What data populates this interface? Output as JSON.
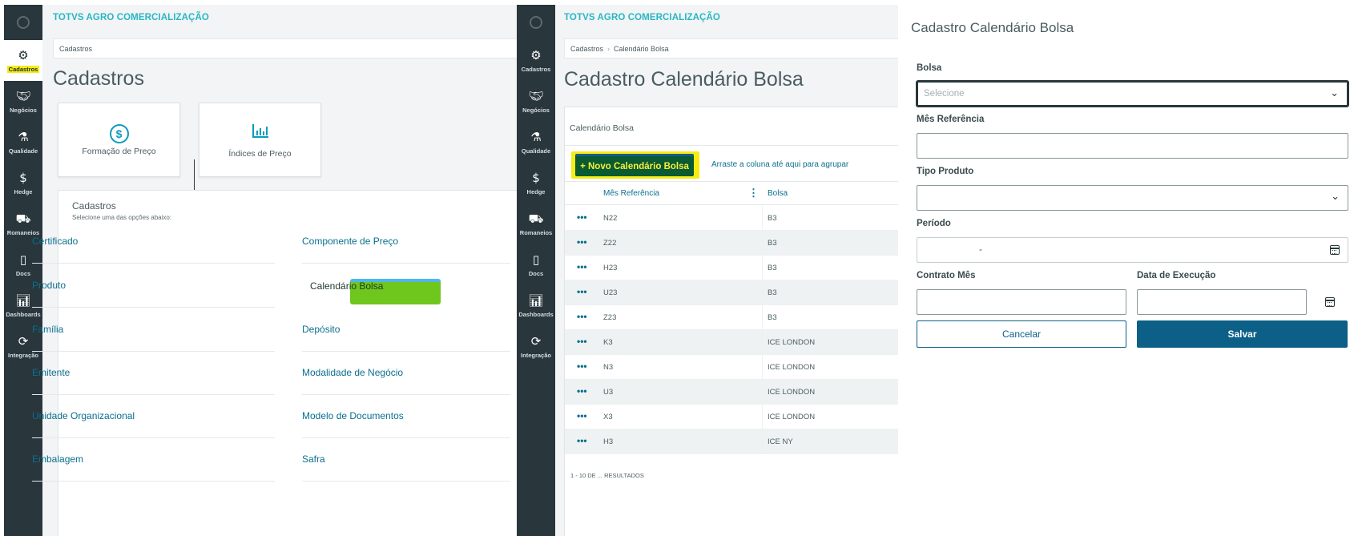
{
  "left": {
    "app_title": "TOTVS AGRO COMERCIALIZAÇÃO",
    "breadcrumb": "Cadastros",
    "page_title": "Cadastros",
    "nav": [
      {
        "label": "Cadastros",
        "icon": "gear-icon"
      },
      {
        "label": "Negócios",
        "icon": "handshake-icon"
      },
      {
        "label": "Qualidade",
        "icon": "flask-icon"
      },
      {
        "label": "Hedge",
        "icon": "hedge-icon"
      },
      {
        "label": "Romaneios",
        "icon": "truck-icon"
      },
      {
        "label": "Docs",
        "icon": "document-icon"
      },
      {
        "label": "Dashboards",
        "icon": "bar-chart-icon"
      },
      {
        "label": "Integração",
        "icon": "sync-icon"
      }
    ],
    "cards": [
      {
        "label": "Formação de Preço",
        "icon": "dollar-icon"
      },
      {
        "label": "Índices de Preço",
        "icon": "bar-chart-icon"
      }
    ],
    "box_title": "Cadastros",
    "box_subtitle": "Selecione uma das opções abaixo:",
    "links_col1": [
      "Certificado",
      "Produto",
      "Família",
      "Emitente",
      "Unidade Organizacional",
      "Embalagem"
    ],
    "links_col2": [
      "Componente de Preço",
      "Calendário Bolsa",
      "Depósito",
      "Modalidade de Negócio",
      "Modelo de Documentos",
      "Safra"
    ]
  },
  "mid": {
    "app_title": "TOTVS AGRO COMERCIALIZAÇÃO",
    "breadcrumb": [
      "Cadastros",
      "Calendário Bolsa"
    ],
    "page_title": "Cadastro Calendário Bolsa",
    "nav": [
      {
        "label": "Cadastros"
      },
      {
        "label": "Negócios"
      },
      {
        "label": "Qualidade"
      },
      {
        "label": "Hedge"
      },
      {
        "label": "Romaneios"
      },
      {
        "label": "Docs"
      },
      {
        "label": "Dashboards"
      },
      {
        "label": "Integração"
      }
    ],
    "grid_title": "Calendário Bolsa",
    "new_button": "+ Novo Calendário Bolsa",
    "group_hint": "Arraste a coluna até aqui para agrupar",
    "columns": [
      "Mês Referência",
      "Bolsa"
    ],
    "rows": [
      {
        "mes": "N22",
        "bolsa": "B3"
      },
      {
        "mes": "Z22",
        "bolsa": "B3"
      },
      {
        "mes": "H23",
        "bolsa": "B3"
      },
      {
        "mes": "U23",
        "bolsa": "B3"
      },
      {
        "mes": "Z23",
        "bolsa": "B3"
      },
      {
        "mes": "K3",
        "bolsa": "ICE LONDON"
      },
      {
        "mes": "N3",
        "bolsa": "ICE LONDON"
      },
      {
        "mes": "U3",
        "bolsa": "ICE LONDON"
      },
      {
        "mes": "X3",
        "bolsa": "ICE LONDON"
      },
      {
        "mes": "H3",
        "bolsa": "ICE NY"
      }
    ],
    "results": "1 - 10 DE ... RESULTADOS"
  },
  "form": {
    "title": "Cadastro Calendário Bolsa",
    "bolsa_label": "Bolsa",
    "bolsa_placeholder": "Selecione",
    "mes_label": "Mês Referência",
    "tipo_label": "Tipo Produto",
    "periodo_label": "Período",
    "periodo_sep": "-",
    "contrato_label": "Contrato Mês",
    "execucao_label": "Data de Execução",
    "cancel": "Cancelar",
    "save": "Salvar"
  },
  "colors": {
    "sidebar": "#29363b",
    "accent": "#0c5f86",
    "link": "#0a6f8f",
    "title_teal": "#29b6c5",
    "highlight_yellow": "#f5ec14",
    "highlight_green": "#6fc61d"
  }
}
